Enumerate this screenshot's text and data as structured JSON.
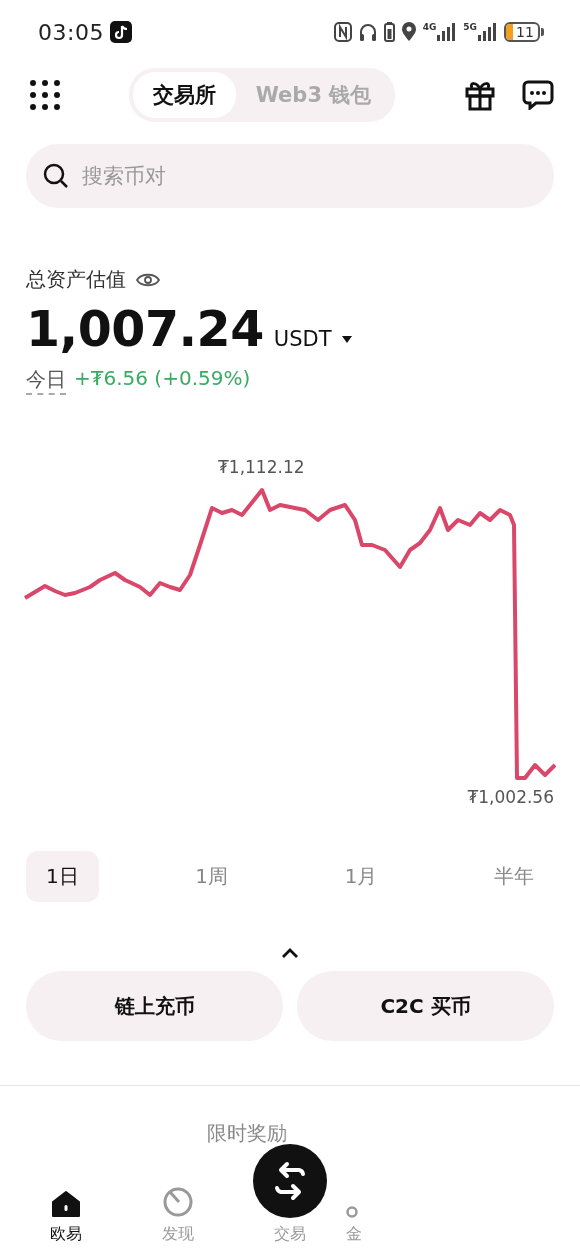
{
  "status_bar": {
    "time": "03:05",
    "network_1": "4G",
    "network_2": "5G",
    "battery": "11"
  },
  "header": {
    "segments": [
      {
        "label": "交易所",
        "selected": true
      },
      {
        "label": "Web3 钱包",
        "selected": false
      }
    ]
  },
  "search": {
    "placeholder": "搜索币对"
  },
  "assets": {
    "label": "总资产估值",
    "amount": "1,007.24",
    "currency": "USDT",
    "change_label": "今日",
    "change": "+₮6.56 (+0.59%)"
  },
  "chart": {
    "high_label": "₮1,112.12",
    "low_label": "₮1,002.56"
  },
  "periods": [
    {
      "label": "1日",
      "selected": true
    },
    {
      "label": "1周",
      "selected": false
    },
    {
      "label": "1月",
      "selected": false
    },
    {
      "label": "半年",
      "selected": false
    }
  ],
  "actions": [
    "链上充币",
    "C2C 买币"
  ],
  "promo": {
    "title": "限时奖励"
  },
  "nav": [
    {
      "label": "欧易",
      "kind": "home",
      "selected": true
    },
    {
      "label": "发现",
      "kind": "discover",
      "selected": false
    },
    {
      "label": "交易",
      "kind": "trade",
      "selected": false
    },
    {
      "label": "金",
      "kind": "partial",
      "selected": false
    }
  ]
}
